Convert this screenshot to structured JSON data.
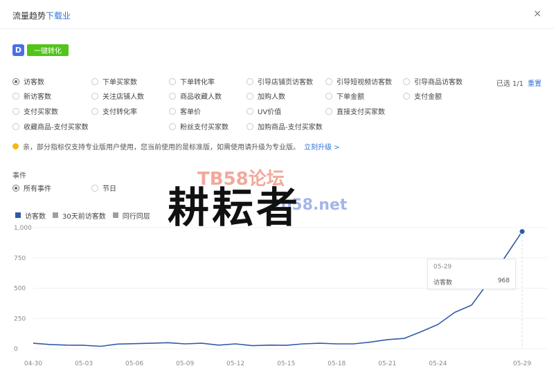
{
  "header": {
    "title_main": "流量趋势",
    "title_link": "下载业",
    "close_icon": "×"
  },
  "toolbar": {
    "logo_letter": "D",
    "convert_label": "一键转化"
  },
  "metrics": [
    {
      "label": "访客数",
      "checked": true
    },
    {
      "label": "下单买家数",
      "checked": false
    },
    {
      "label": "下单转化率",
      "checked": false
    },
    {
      "label": "引导店铺页访客数",
      "checked": false
    },
    {
      "label": "引导短视频访客数",
      "checked": false
    },
    {
      "label": "引导商品访客数",
      "checked": false
    },
    {
      "label": "新访客数",
      "checked": false
    },
    {
      "label": "关注店铺人数",
      "checked": false
    },
    {
      "label": "商品收藏人数",
      "checked": false
    },
    {
      "label": "加购人数",
      "checked": false
    },
    {
      "label": "下单金额",
      "checked": false
    },
    {
      "label": "支付金额",
      "checked": false
    },
    {
      "label": "支付买家数",
      "checked": false
    },
    {
      "label": "支付转化率",
      "checked": false
    },
    {
      "label": "客单价",
      "checked": false
    },
    {
      "label": "UV价值",
      "checked": false
    },
    {
      "label": "直接支付买家数",
      "checked": false
    },
    {
      "label": "收藏商品-支付买家数",
      "checked": false
    },
    {
      "label": "粉丝支付买家数",
      "checked": false
    },
    {
      "label": "加购商品-支付买家数",
      "checked": false
    }
  ],
  "selection": {
    "selected_text": "已选 1/1",
    "reset_label": "重置"
  },
  "notice": {
    "text": "亲，部分指标仅支持专业版用户使用，您当前使用的是标准版，如需使用请升级为专业版。",
    "upgrade_label": "立刻升级 >"
  },
  "events": {
    "label": "事件",
    "options": [
      {
        "label": "所有事件",
        "checked": true
      },
      {
        "label": "节日",
        "checked": false
      }
    ]
  },
  "legend": [
    {
      "label": "访客数",
      "color": "#2f5aa8"
    },
    {
      "label": "30天前访客数",
      "color": "#9aa0a6"
    },
    {
      "label": "同行同层",
      "color": "#9aa0a6"
    }
  ],
  "tooltip": {
    "date": "05-29",
    "label": "访客数",
    "value": "968"
  },
  "watermark": {
    "text": "耕耘者",
    "forum": "TB58论坛",
    "url": "tb58.net"
  },
  "chart_data": {
    "type": "line",
    "x": [
      "04-30",
      "05-01",
      "05-02",
      "05-03",
      "05-04",
      "05-05",
      "05-06",
      "05-07",
      "05-08",
      "05-09",
      "05-10",
      "05-11",
      "05-12",
      "05-13",
      "05-14",
      "05-15",
      "05-16",
      "05-17",
      "05-18",
      "05-19",
      "05-20",
      "05-21",
      "05-22",
      "05-23",
      "05-24",
      "05-25",
      "05-26",
      "05-27",
      "05-28",
      "05-29"
    ],
    "x_ticks": [
      "04-30",
      "05-03",
      "05-06",
      "05-09",
      "05-12",
      "05-15",
      "05-18",
      "05-21",
      "05-24",
      "05-29"
    ],
    "y_ticks": [
      "0",
      "250",
      "500",
      "750",
      "1,000"
    ],
    "ylim": [
      0,
      1000
    ],
    "series": [
      {
        "name": "访客数",
        "color": "#2f5aa8",
        "values": [
          45,
          35,
          30,
          28,
          20,
          38,
          42,
          45,
          50,
          40,
          45,
          30,
          40,
          25,
          30,
          28,
          40,
          45,
          40,
          40,
          55,
          75,
          85,
          140,
          200,
          300,
          360,
          550,
          760,
          968
        ]
      }
    ],
    "grid": true,
    "legend_position": "top-left"
  }
}
